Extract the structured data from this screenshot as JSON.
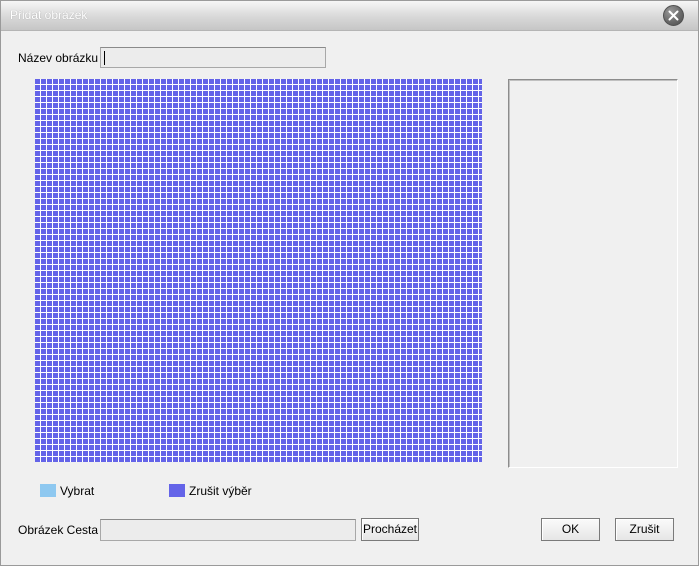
{
  "window": {
    "title": "Přidat obrázek",
    "close_icon": "close-icon"
  },
  "name_field": {
    "label": "Název obrázku",
    "value": ""
  },
  "grid": {
    "cell_color": "#6464e8",
    "selected_cell_color": "#8ec8f0",
    "gap_color": "#ffffff",
    "state": "all-cells-unselected"
  },
  "legend": {
    "select": {
      "label": "Vybrat",
      "color": "#8ec8f0"
    },
    "deselect": {
      "label": "Zrušit výběr",
      "color": "#6464e8"
    }
  },
  "path_field": {
    "label": "Obrázek Cesta",
    "value": "",
    "browse_label": "Procházet"
  },
  "buttons": {
    "ok_label": "OK",
    "cancel_label": "Zrušit"
  }
}
